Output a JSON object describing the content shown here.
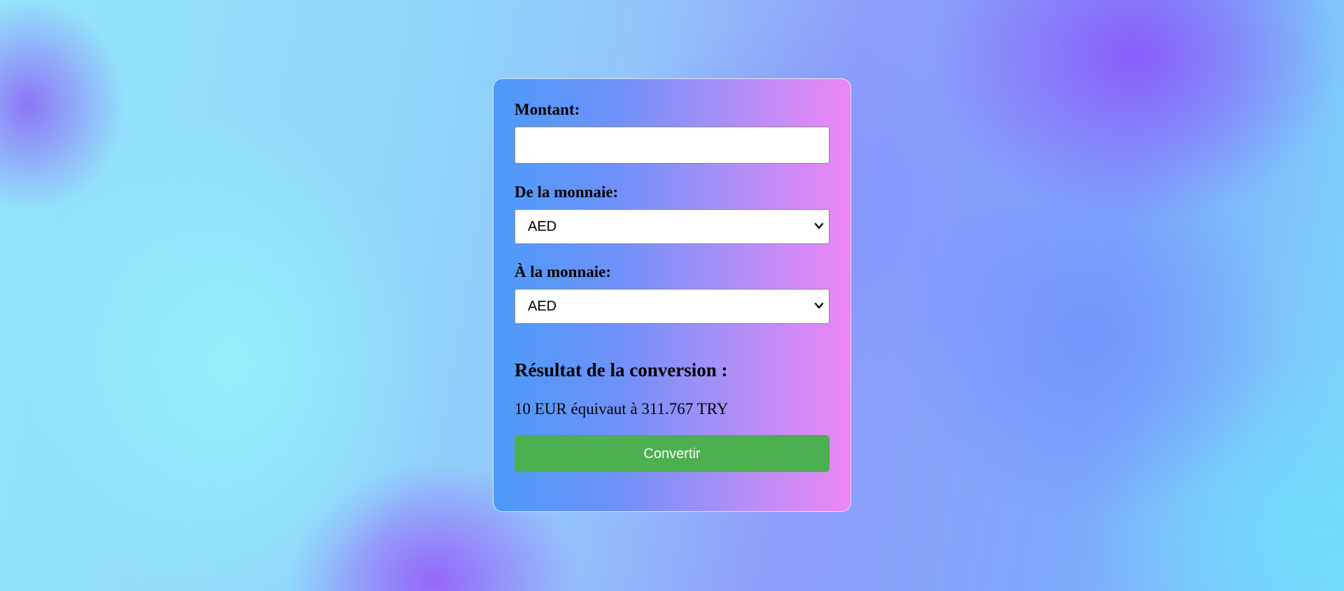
{
  "form": {
    "amount_label": "Montant:",
    "amount_value": "",
    "from_label": "De la monnaie:",
    "from_selected": "AED",
    "to_label": "À la monnaie:",
    "to_selected": "AED",
    "submit_label": "Convertir"
  },
  "result": {
    "title": "Résultat de la conversion :",
    "text": "10 EUR équivaut à 311.767 TRY"
  },
  "colors": {
    "button": "#4caf50",
    "card_gradient_start": "#4b9bf9",
    "card_gradient_end": "#ee86f6"
  },
  "icons": {
    "select_arrow": "chevron-down-icon"
  }
}
